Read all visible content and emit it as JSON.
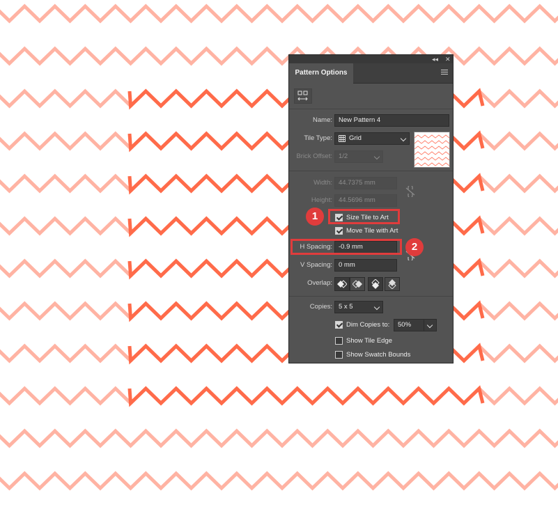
{
  "colors": {
    "zigzag_light": "#ffb3a3",
    "zigzag_dark": "#ff6b4a",
    "panel_bg": "#535353",
    "callout": "#e03c3c"
  },
  "panel": {
    "title": "Pattern Options",
    "collapse_glyph": "◂◂",
    "close_glyph": "✕",
    "fields": {
      "name_label": "Name:",
      "name_value": "New Pattern 4",
      "tile_type_label": "Tile Type:",
      "tile_type_value": "Grid",
      "brick_offset_label": "Brick Offset:",
      "brick_offset_value": "1/2",
      "width_label": "Width:",
      "width_value": "44.7375 mm",
      "height_label": "Height:",
      "height_value": "44.5696 mm",
      "size_tile_to_art": "Size Tile to Art",
      "move_tile_with_art": "Move Tile with Art",
      "h_spacing_label": "H Spacing:",
      "h_spacing_value": "-0.9 mm",
      "v_spacing_label": "V Spacing:",
      "v_spacing_value": "0 mm",
      "overlap_label": "Overlap:",
      "copies_label": "Copies:",
      "copies_value": "5 x 5",
      "dim_copies_label": "Dim Copies to:",
      "dim_copies_value": "50%",
      "show_tile_edge": "Show Tile Edge",
      "show_swatch_bounds": "Show Swatch Bounds"
    },
    "checkboxes": {
      "size_tile_to_art": true,
      "move_tile_with_art": true,
      "dim_copies": true,
      "show_tile_edge": false,
      "show_swatch_bounds": false
    },
    "icons": [
      "pattern-tile-tool-icon",
      "grid-icon",
      "link-icon",
      "overlap-left-icon",
      "overlap-right-icon",
      "overlap-top-icon",
      "overlap-bottom-icon"
    ]
  },
  "callouts": {
    "badge_1": "1",
    "badge_2": "2"
  }
}
